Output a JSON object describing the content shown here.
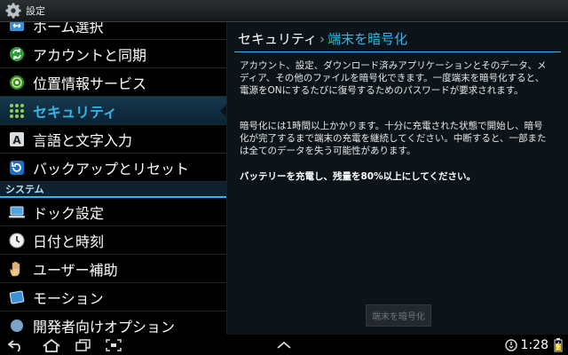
{
  "app": {
    "title": "設定",
    "icon": "gear-icon"
  },
  "sidebar": {
    "items_top": [
      {
        "label": "ホーム選択",
        "icon": "home-switch-icon",
        "selected": false
      },
      {
        "label": "アカウントと同期",
        "icon": "sync-icon",
        "selected": false
      },
      {
        "label": "位置情報サービス",
        "icon": "location-icon",
        "selected": false
      },
      {
        "label": "セキュリティ",
        "icon": "security-grid-icon",
        "selected": true
      },
      {
        "label": "言語と文字入力",
        "icon": "keyboard-a-icon",
        "selected": false
      },
      {
        "label": "バックアップとリセット",
        "icon": "backup-reset-icon",
        "selected": false
      }
    ],
    "section_header": "システム",
    "items_system": [
      {
        "label": "ドック設定",
        "icon": "laptop-icon",
        "selected": false
      },
      {
        "label": "日付と時刻",
        "icon": "clock-icon",
        "selected": false
      },
      {
        "label": "ユーザー補助",
        "icon": "hand-icon",
        "selected": false
      },
      {
        "label": "モーション",
        "icon": "tablet-motion-icon",
        "selected": false
      },
      {
        "label": "開発者向けオプション",
        "icon": "developer-icon",
        "selected": false
      }
    ]
  },
  "detail": {
    "breadcrumb_parent": "セキュリティ",
    "breadcrumb_sep": "›",
    "breadcrumb_current": "端末を暗号化",
    "paragraph_1": "アカウント、設定、ダウンロード済みアプリケーションとそのデータ、メディア、その他のファイルを暗号化できます。一度端末を暗号化すると、電源をONにするたびに復号するためのパスワードが要求されます。",
    "paragraph_2": "暗号化には1時間以上かかります。十分に充電された状態で開始し、暗号化が完了するまで端末の充電を継続してください。中断すると、一部または全てのデータを失う可能性があります。",
    "paragraph_3": "バッテリーを充電し、残量を80%以上にしてください。",
    "button_label": "端末を暗号化",
    "button_enabled": false
  },
  "navbar": {
    "buttons": [
      "back-icon",
      "home-icon",
      "recent-apps-icon",
      "screenshot-icon",
      "chevron-up-icon"
    ],
    "clock": "1:28",
    "status_icons": [
      "sync-status-icon",
      "battery-charging-icon"
    ]
  },
  "colors": {
    "accent": "#33b5e5",
    "detail_bg": "#0d1419",
    "selected_bg": "#16384f",
    "section_header_bg": "#10202c"
  }
}
